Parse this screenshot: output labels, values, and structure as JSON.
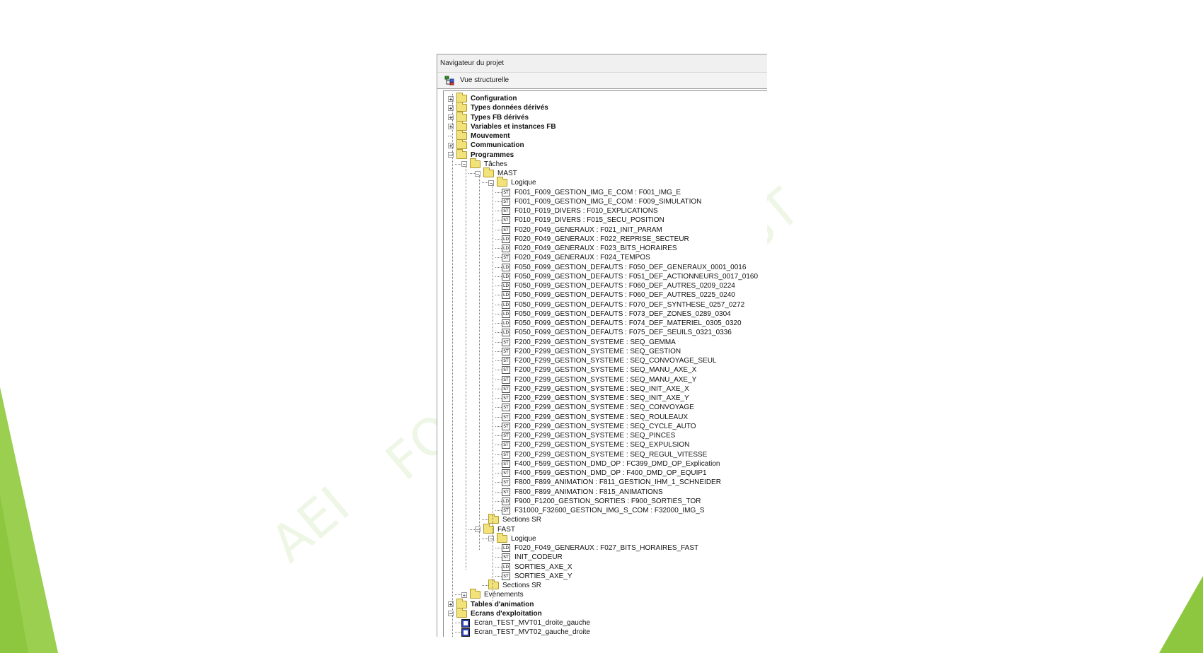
{
  "panel": {
    "title": "Navigateur du projet",
    "view_label": "Vue structurelle"
  },
  "watermark": [
    "AEI",
    "FO",
    "ST"
  ],
  "tree": {
    "top": [
      {
        "label": "Configuration",
        "expander": "+",
        "icon": "folder"
      },
      {
        "label": "Types données dérivés",
        "expander": "+",
        "icon": "folder"
      },
      {
        "label": "Types FB dérivés",
        "expander": "+",
        "icon": "folder"
      },
      {
        "label": "Variables et instances FB",
        "expander": "+",
        "icon": "folder"
      },
      {
        "label": "Mouvement",
        "expander": "",
        "icon": "folder"
      },
      {
        "label": "Communication",
        "expander": "+",
        "icon": "folder"
      },
      {
        "label": "Programmes",
        "expander": "−",
        "icon": "folder-open"
      }
    ],
    "taches": "Tâches",
    "mast": "MAST",
    "logique": "Logique",
    "mast_sections": [
      {
        "type": "ST",
        "label": "F001_F009_GESTION_IMG_E_COM : F001_IMG_E"
      },
      {
        "type": "ST",
        "label": "F001_F009_GESTION_IMG_E_COM : F009_SIMULATION"
      },
      {
        "type": "ST",
        "label": "F010_F019_DIVERS : F010_EXPLICATIONS"
      },
      {
        "type": "ST",
        "label": "F010_F019_DIVERS : F015_SECU_POSITION"
      },
      {
        "type": "ST",
        "label": "F020_F049_GENERAUX : F021_INIT_PARAM"
      },
      {
        "type": "LD",
        "label": "F020_F049_GENERAUX : F022_REPRISE_SECTEUR"
      },
      {
        "type": "LD",
        "label": "F020_F049_GENERAUX : F023_BITS_HORAIRES"
      },
      {
        "type": "ST",
        "label": "F020_F049_GENERAUX : F024_TEMPOS"
      },
      {
        "type": "LD",
        "label": "F050_F099_GESTION_DEFAUTS : F050_DEF_GENERAUX_0001_0016"
      },
      {
        "type": "LD",
        "label": "F050_F099_GESTION_DEFAUTS : F051_DEF_ACTIONNEURS_0017_0160"
      },
      {
        "type": "LD",
        "label": "F050_F099_GESTION_DEFAUTS : F060_DEF_AUTRES_0209_0224"
      },
      {
        "type": "LD",
        "label": "F050_F099_GESTION_DEFAUTS : F060_DEF_AUTRES_0225_0240"
      },
      {
        "type": "LD",
        "label": "F050_F099_GESTION_DEFAUTS : F070_DEF_SYNTHESE_0257_0272"
      },
      {
        "type": "LD",
        "label": "F050_F099_GESTION_DEFAUTS : F073_DEF_ZONES_0289_0304"
      },
      {
        "type": "LD",
        "label": "F050_F099_GESTION_DEFAUTS : F074_DEF_MATERIEL_0305_0320"
      },
      {
        "type": "LD",
        "label": "F050_F099_GESTION_DEFAUTS : F075_DEF_SEUILS_0321_0336"
      },
      {
        "type": "ST",
        "label": "F200_F299_GESTION_SYSTEME : SEQ_GEMMA"
      },
      {
        "type": "ST",
        "label": "F200_F299_GESTION_SYSTEME : SEQ_GESTION"
      },
      {
        "type": "ST",
        "label": "F200_F299_GESTION_SYSTEME : SEQ_CONVOYAGE_SEUL"
      },
      {
        "type": "ST",
        "label": "F200_F299_GESTION_SYSTEME : SEQ_MANU_AXE_X"
      },
      {
        "type": "ST",
        "label": "F200_F299_GESTION_SYSTEME : SEQ_MANU_AXE_Y"
      },
      {
        "type": "ST",
        "label": "F200_F299_GESTION_SYSTEME : SEQ_INIT_AXE_X"
      },
      {
        "type": "ST",
        "label": "F200_F299_GESTION_SYSTEME : SEQ_INIT_AXE_Y"
      },
      {
        "type": "ST",
        "label": "F200_F299_GESTION_SYSTEME : SEQ_CONVOYAGE"
      },
      {
        "type": "ST",
        "label": "F200_F299_GESTION_SYSTEME : SEQ_ROULEAUX"
      },
      {
        "type": "ST",
        "label": "F200_F299_GESTION_SYSTEME : SEQ_CYCLE_AUTO"
      },
      {
        "type": "ST",
        "label": "F200_F299_GESTION_SYSTEME : SEQ_PINCES"
      },
      {
        "type": "ST",
        "label": "F200_F299_GESTION_SYSTEME : SEQ_EXPULSION"
      },
      {
        "type": "ST",
        "label": "F200_F299_GESTION_SYSTEME : SEQ_REGUL_VITESSE"
      },
      {
        "type": "ST",
        "label": "F400_F599_GESTION_DMD_OP : FC399_DMD_OP_Explication"
      },
      {
        "type": "ST",
        "label": "F400_F599_GESTION_DMD_OP : F400_DMD_OP_EQUIP1"
      },
      {
        "type": "ST",
        "label": "F800_F899_ANIMATION : F811_GESTION_IHM_1_SCHNEIDER"
      },
      {
        "type": "ST",
        "label": "F800_F899_ANIMATION : F815_ANIMATIONS"
      },
      {
        "type": "LD",
        "label": "F900_F1200_GESTION_SORTIES : F900_SORTIES_TOR"
      },
      {
        "type": "ST",
        "label": "F31000_F32600_GESTION_IMG_S_COM : F32000_IMG_S"
      }
    ],
    "sections_sr": "Sections SR",
    "fast": "FAST",
    "fast_sections": [
      {
        "type": "LD",
        "label": "F020_F049_GENERAUX : F027_BITS_HORAIRES_FAST"
      },
      {
        "type": "ST",
        "label": "INIT_CODEUR"
      },
      {
        "type": "LD",
        "label": "SORTIES_AXE_X"
      },
      {
        "type": "ST",
        "label": "SORTIES_AXE_Y"
      }
    ],
    "evenements": "Evénements",
    "bottom": [
      {
        "label": "Tables d'animation",
        "expander": "+",
        "icon": "folder"
      },
      {
        "label": "Ecrans d'exploitation",
        "expander": "−",
        "icon": "folder-open"
      }
    ],
    "screens": [
      "Ecran_TEST_MVT01_droite_gauche",
      "Ecran_TEST_MVT02_gauche_droite"
    ]
  },
  "colors": {
    "accent_green": "#8dc63f",
    "folder_yellow": "#f2e27a",
    "screen_icon_blue": "#2c46b8"
  }
}
